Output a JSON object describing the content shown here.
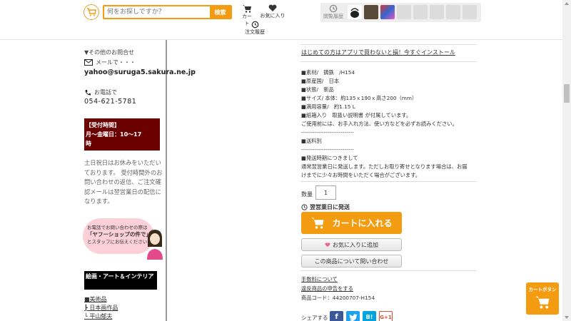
{
  "header": {
    "search_placeholder": "何をお探しですか？",
    "search_button": "検索",
    "cart_label": "カート",
    "favorites_label": "お気に入り",
    "orders_label": "注文履歴",
    "history_label": "閲覧履歴",
    "accent_color": "#f39c12"
  },
  "sidebar": {
    "other_inquiries": "▼その他のお問合せ",
    "email_label": "メールで・・・",
    "email": "yahoo@suruga5.sakura.ne.jp",
    "phone_label": "お電話で",
    "phone": "054-621-5781",
    "hours_title": "【受付時間】",
    "hours_line1": "月～金曜日：10～17",
    "hours_line2": "時",
    "notice": "土日祝日はお休みをいただいております。 受付時間外のお問い合わせの返信、ご注文確認メールは翌営業日の配信になります。",
    "bubble_line1": "お電話でお問い合わせの際は",
    "bubble_line2": "「ヤフーショップの件で」",
    "bubble_line3": "とスタッフにお伝えください",
    "category_title": "絵画・アート＆インテリア",
    "cat_link1": "■美術品",
    "cat_link2": "┣ 日本画作品",
    "cat_link3": "└ 平山郁夫"
  },
  "main": {
    "app_link": "はじめての方はアプリで買わないと損！今すぐインストール",
    "desc": [
      "■素材/　鋳鉄　/H154",
      "■原産国/　日本",
      "■状態/　新品",
      "■サイズ/ 本体：約135ｘ190ｘ高さ200（mm）",
      "■満用容量/　約1.15 L",
      "■紙箱入り　取扱い説明書 が付属しています。",
      "ご使用前には、お手入れ方法、使い方などを必ずお読みください。",
      "----------------------------",
      "■送料別",
      "----------------------------",
      "■発送時期につきまして",
      "通常翌営業日に発送します。ただしお取り寄せとなります場合は、お届",
      "けまでに少々お時間をいただく場合がございます。"
    ],
    "qty_label": "数量",
    "qty_value": "1",
    "ship_note": "翌営業日に発送",
    "cart_button": "カートに入れる",
    "fav_button": "お気に入りに追加",
    "inquiry_button": "この商品について問い合わせ",
    "fee_link": "手数料について",
    "law_link": "違反商品の申告をする",
    "product_code": "商品コード：44200707-H154",
    "share_label": "シェアする",
    "float_cart_label": "カートボタン"
  }
}
